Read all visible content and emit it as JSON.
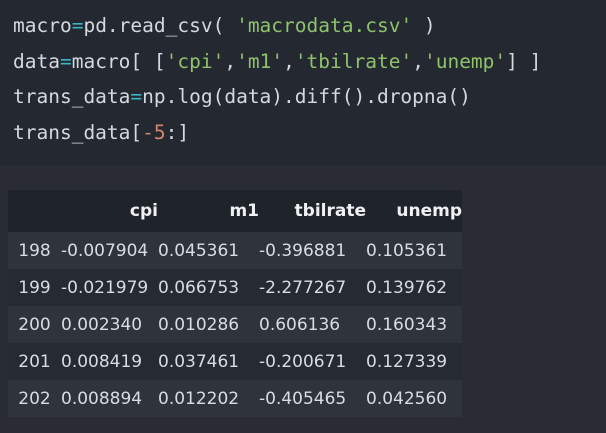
{
  "code": {
    "lines": [
      [
        {
          "t": "macro",
          "k": "plain"
        },
        {
          "t": "=",
          "k": "op"
        },
        {
          "t": "pd.read_csv( ",
          "k": "plain"
        },
        {
          "t": "'macrodata.csv'",
          "k": "str"
        },
        {
          "t": " )",
          "k": "plain"
        }
      ],
      [
        {
          "t": "data",
          "k": "plain"
        },
        {
          "t": "=",
          "k": "op"
        },
        {
          "t": "macro[ [",
          "k": "plain"
        },
        {
          "t": "'cpi'",
          "k": "str"
        },
        {
          "t": ",",
          "k": "plain"
        },
        {
          "t": "'m1'",
          "k": "str"
        },
        {
          "t": ",",
          "k": "plain"
        },
        {
          "t": "'tbilrate'",
          "k": "str"
        },
        {
          "t": ",",
          "k": "plain"
        },
        {
          "t": "'unemp'",
          "k": "str"
        },
        {
          "t": "] ]",
          "k": "plain"
        }
      ],
      [
        {
          "t": "trans_data",
          "k": "plain"
        },
        {
          "t": "=",
          "k": "op"
        },
        {
          "t": "np.log(data).diff().dropna()",
          "k": "plain"
        }
      ],
      [
        {
          "t": "trans_data[",
          "k": "plain"
        },
        {
          "t": "-5",
          "k": "num"
        },
        {
          "t": ":]",
          "k": "plain"
        }
      ]
    ]
  },
  "table": {
    "index_header": "",
    "columns": [
      "cpi",
      "m1",
      "tbilrate",
      "unemp"
    ],
    "rows": [
      {
        "index": "198",
        "values": [
          "-0.007904",
          "0.045361",
          "-0.396881",
          "0.105361"
        ]
      },
      {
        "index": "199",
        "values": [
          "-0.021979",
          "0.066753",
          "-2.277267",
          "0.139762"
        ]
      },
      {
        "index": "200",
        "values": [
          "0.002340",
          "0.010286",
          "0.606136",
          "0.160343"
        ]
      },
      {
        "index": "201",
        "values": [
          "0.008419",
          "0.037461",
          "-0.200671",
          "0.127339"
        ]
      },
      {
        "index": "202",
        "values": [
          "0.008894",
          "0.012202",
          "-0.405465",
          "0.042560"
        ]
      }
    ]
  },
  "colors": {
    "code_background": "#242830",
    "output_background": "#2a2c34",
    "operator": "#39b6c7",
    "string": "#8ec26b",
    "number": "#d7856f",
    "text": "#d5d8de"
  }
}
